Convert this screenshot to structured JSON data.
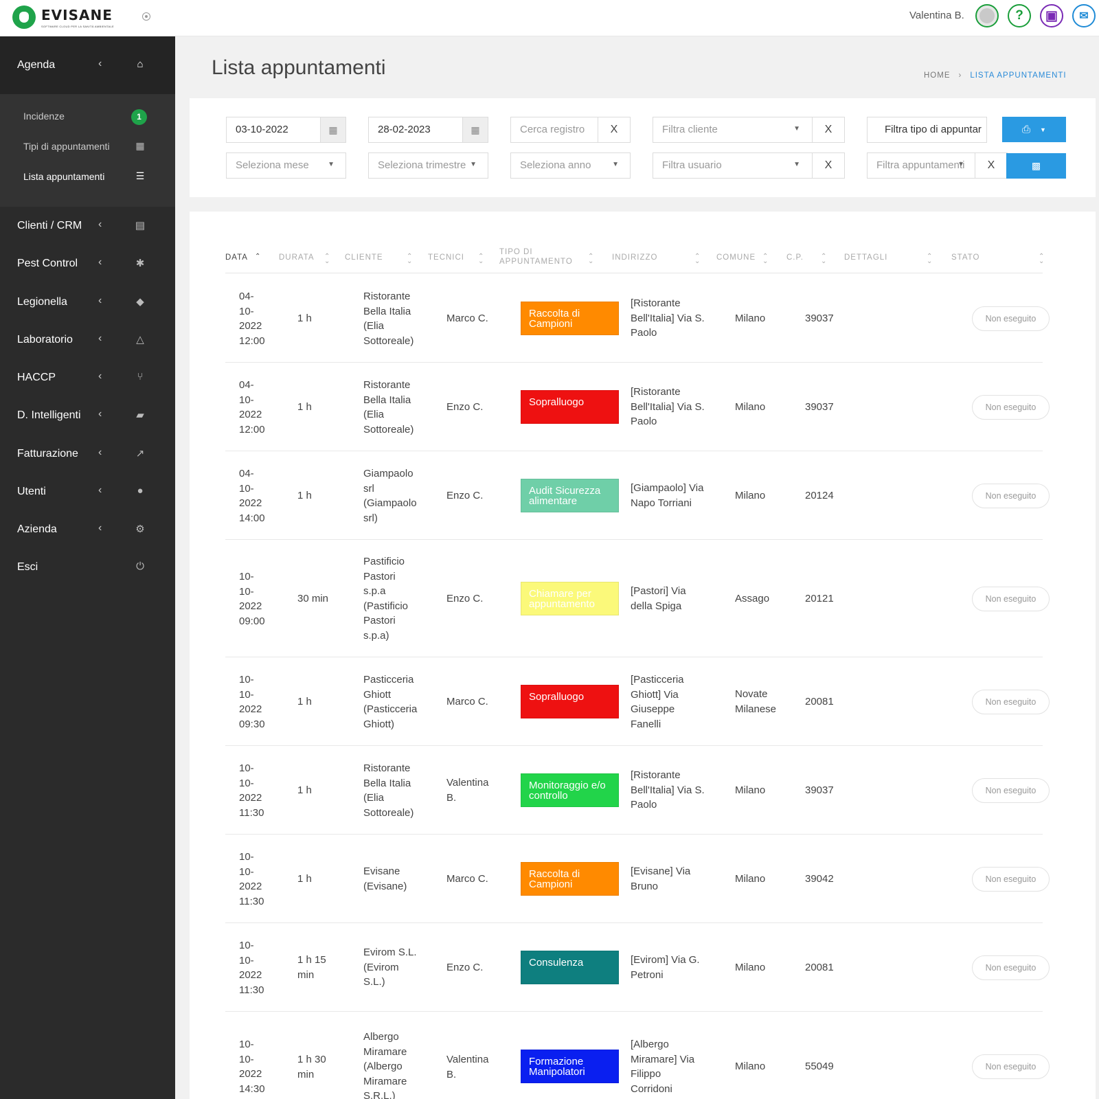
{
  "app": {
    "logo_name": "EVISANE",
    "logo_tagline": "SOFTWARE CLOUD PER LA SANITÀ AMBIENTALE",
    "user_name": "Valentina B."
  },
  "sidebar": {
    "header": {
      "label": "Agenda",
      "icon": "home-icon"
    },
    "sub_items": [
      {
        "label": "Incidenze",
        "badge": "1"
      },
      {
        "label": "Tipi di appuntamenti",
        "icon": "calendar-icon"
      },
      {
        "label": "Lista appuntamenti",
        "icon": "list-icon",
        "active": true
      }
    ],
    "items": [
      {
        "label": "Clienti / CRM",
        "icon": "id-card-icon"
      },
      {
        "label": "Pest Control",
        "icon": "bug-icon"
      },
      {
        "label": "Legionella",
        "icon": "drop-icon"
      },
      {
        "label": "Laboratorio",
        "icon": "flask-icon"
      },
      {
        "label": "HACCP",
        "icon": "cutlery-icon"
      },
      {
        "label": "D. Intelligenti",
        "icon": "folder-open-icon"
      },
      {
        "label": "Fatturazione",
        "icon": "line-chart-icon"
      },
      {
        "label": "Utenti",
        "icon": "user-icon"
      },
      {
        "label": "Azienda",
        "icon": "gear-icon"
      },
      {
        "label": "Esci",
        "icon": "power-icon"
      }
    ]
  },
  "page": {
    "title": "Lista appuntamenti",
    "breadcrumb": {
      "home": "HOME",
      "separator": "›",
      "current": "LISTA APPUNTAMENTI"
    }
  },
  "filters": {
    "date_from": "03-10-2022",
    "date_to": "28-02-2023",
    "search_placeholder": "Cerca registro",
    "client_placeholder": "Filtra cliente",
    "type_placeholder": "Filtra tipo di appuntar",
    "month_placeholder": "Seleziona mese",
    "quarter_placeholder": "Seleziona trimestre",
    "year_placeholder": "Seleziona anno",
    "user_placeholder": "Filtra usuario",
    "appointment_placeholder": "Filtra appuntamenti",
    "clear_label": "X"
  },
  "table": {
    "headers": {
      "data": "Data",
      "durata": "Durata",
      "cliente": "Cliente",
      "tecnici": "Tecnici",
      "tipo": "Tipo di appuntamento",
      "indirizzo": "Indirizzo",
      "comune": "Comune",
      "cp": "C.P.",
      "dettagli": "Dettagli",
      "stato": "Stato"
    },
    "rows": [
      {
        "date": "04-\n10-\n2022\n12:00",
        "duration": "1 h",
        "client": "Ristorante\nBella Italia\n(Elia\nSottoreale)",
        "tech": "Marco C.",
        "type": "Raccolta di Campioni",
        "type_color": "#ff8a00",
        "type_text_color": "#ffffff",
        "address": "[Ristorante\nBell'Italia] Via S.\nPaolo",
        "city": "Milano",
        "cp": "39037",
        "details": "",
        "status": "Non eseguito"
      },
      {
        "date": "04-\n10-\n2022\n12:00",
        "duration": "1 h",
        "client": "Ristorante\nBella Italia\n(Elia\nSottoreale)",
        "tech": "Enzo C.",
        "type": "Sopralluogo",
        "type_color": "#ee1111",
        "type_text_color": "#ffffff",
        "address": "[Ristorante\nBell'Italia] Via S.\nPaolo",
        "city": "Milano",
        "cp": "39037",
        "details": "",
        "status": "Non eseguito"
      },
      {
        "date": "04-\n10-\n2022\n14:00",
        "duration": "1 h",
        "client": "Giampaolo\nsrl\n(Giampaolo\nsrl)",
        "tech": "Enzo C.",
        "type": "Audit Sicurezza alimentare",
        "type_color": "#6fcfa8",
        "type_text_color": "#ffffff",
        "address": "[Giampaolo] Via\nNapo Torriani",
        "city": "Milano",
        "cp": "20124",
        "details": "",
        "status": "Non eseguito"
      },
      {
        "date": "10-\n10-\n2022\n09:00",
        "duration": "30 min",
        "client": "Pastificio\nPastori\ns.p.a\n(Pastificio\nPastori\ns.p.a)",
        "tech": "Enzo C.",
        "type": "Chiamare per appuntamento",
        "type_color": "#fbf97a",
        "type_text_color": "#ffffff",
        "address": "[Pastori] Via\ndella Spiga",
        "city": "Assago",
        "cp": "20121",
        "details": "",
        "status": "Non eseguito"
      },
      {
        "date": "10-\n10-\n2022\n09:30",
        "duration": "1 h",
        "client": "Pasticceria\nGhiott\n(Pasticceria\nGhiott)",
        "tech": "Marco C.",
        "type": "Sopralluogo",
        "type_color": "#ee1111",
        "type_text_color": "#ffffff",
        "address": "[Pasticceria\nGhiott] Via\nGiuseppe\nFanelli",
        "city": "Novate\nMilanese",
        "cp": "20081",
        "details": "",
        "status": "Non eseguito"
      },
      {
        "date": "10-\n10-\n2022\n11:30",
        "duration": "1 h",
        "client": "Ristorante\nBella Italia\n(Elia\nSottoreale)",
        "tech": "Valentina\nB.",
        "type": "Monitoraggio e/o controllo",
        "type_color": "#22d44a",
        "type_text_color": "#ffffff",
        "address": "[Ristorante\nBell'Italia] Via S.\nPaolo",
        "city": "Milano",
        "cp": "39037",
        "details": "",
        "status": "Non eseguito"
      },
      {
        "date": "10-\n10-\n2022\n11:30",
        "duration": "1 h",
        "client": "Evisane\n(Evisane)",
        "tech": "Marco C.",
        "type": "Raccolta di Campioni",
        "type_color": "#ff8a00",
        "type_text_color": "#ffffff",
        "address": "[Evisane] Via\nBruno",
        "city": "Milano",
        "cp": "39042",
        "details": "",
        "status": "Non eseguito"
      },
      {
        "date": "10-\n10-\n2022\n11:30",
        "duration": "1 h 15\nmin",
        "client": "Evirom S.L.\n(Evirom\nS.L.)",
        "tech": "Enzo C.",
        "type": "Consulenza",
        "type_color": "#0e7f7f",
        "type_text_color": "#ffffff",
        "address": "[Evirom] Via G.\nPetroni",
        "city": "Milano",
        "cp": "20081",
        "details": "",
        "status": "Non eseguito"
      },
      {
        "date": "10-\n10-\n2022\n14:30",
        "duration": "1 h 30\nmin",
        "client": "Albergo\nMiramare\n(Albergo\nMiramare\nS.R.L.)",
        "tech": "Valentina\nB.",
        "type": "Formazione Manipolatori",
        "type_color": "#0a1ff0",
        "type_text_color": "#ffffff",
        "address": "[Albergo\nMiramare] Via\nFilippo\nCorridoni",
        "city": "Milano",
        "cp": "55049",
        "details": "",
        "status": "Non eseguito"
      }
    ]
  }
}
